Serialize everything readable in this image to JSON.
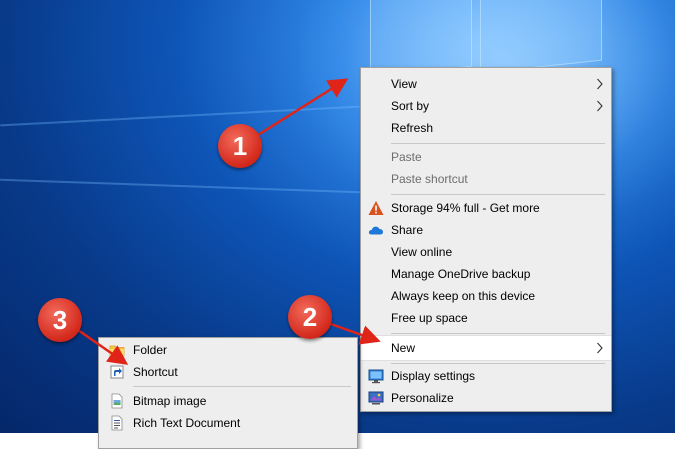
{
  "context_menu": {
    "items": [
      {
        "label": "View",
        "submenu": true,
        "enabled": true
      },
      {
        "label": "Sort by",
        "submenu": true,
        "enabled": true
      },
      {
        "label": "Refresh",
        "enabled": true
      },
      {
        "label": "Paste",
        "enabled": false
      },
      {
        "label": "Paste shortcut",
        "enabled": false
      },
      {
        "label": "Storage 94% full - Get more",
        "icon": "warning-icon",
        "enabled": true
      },
      {
        "label": "Share",
        "icon": "onedrive-cloud-icon",
        "enabled": true
      },
      {
        "label": "View online",
        "enabled": true
      },
      {
        "label": "Manage OneDrive backup",
        "enabled": true
      },
      {
        "label": "Always keep on this device",
        "enabled": true
      },
      {
        "label": "Free up space",
        "enabled": true
      },
      {
        "label": "New",
        "submenu": true,
        "highlighted": true,
        "enabled": true
      },
      {
        "label": "Display settings",
        "icon": "display-settings-icon",
        "enabled": true
      },
      {
        "label": "Personalize",
        "icon": "personalize-icon",
        "enabled": true
      }
    ]
  },
  "new_submenu": {
    "items": [
      {
        "label": "Folder",
        "icon": "folder-icon"
      },
      {
        "label": "Shortcut",
        "icon": "shortcut-icon"
      },
      {
        "label": "Bitmap image",
        "icon": "bitmap-icon"
      },
      {
        "label": "Rich Text Document",
        "icon": "rich-text-document-icon"
      }
    ]
  },
  "callouts": [
    "1",
    "2",
    "3"
  ],
  "colors": {
    "callout": "#d3281b",
    "arrow": "#e02418",
    "menu_bg": "#eeeeee",
    "highlight_bg": "#ffffff",
    "warning": "#d9531e",
    "onedrive": "#1e78d7"
  }
}
